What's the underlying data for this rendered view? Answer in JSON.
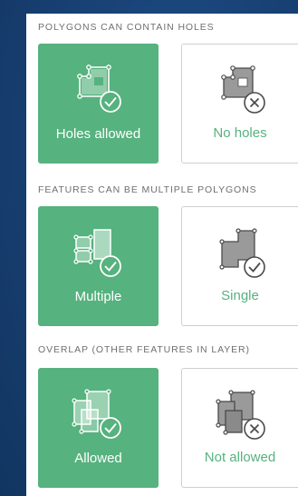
{
  "sections": [
    {
      "title": "POLYGONS CAN CONTAIN HOLES",
      "options": [
        {
          "label": "Holes allowed",
          "icon": "polygon-hole-check-icon",
          "selected": true
        },
        {
          "label": "No holes",
          "icon": "polygon-hole-x-icon",
          "selected": false
        }
      ]
    },
    {
      "title": "FEATURES CAN BE MULTIPLE POLYGONS",
      "options": [
        {
          "label": "Multiple",
          "icon": "multi-polygon-check-icon",
          "selected": true
        },
        {
          "label": "Single",
          "icon": "single-polygon-check-icon",
          "selected": false
        }
      ]
    },
    {
      "title": "OVERLAP (OTHER FEATURES IN LAYER)",
      "options": [
        {
          "label": "Allowed",
          "icon": "overlap-check-icon",
          "selected": true
        },
        {
          "label": "Not allowed",
          "icon": "overlap-x-icon",
          "selected": false
        }
      ]
    }
  ],
  "colors": {
    "accent": "#56b27e",
    "background": "#173f72",
    "panel": "#ffffff",
    "icon_gray": "#9a9a9a"
  }
}
